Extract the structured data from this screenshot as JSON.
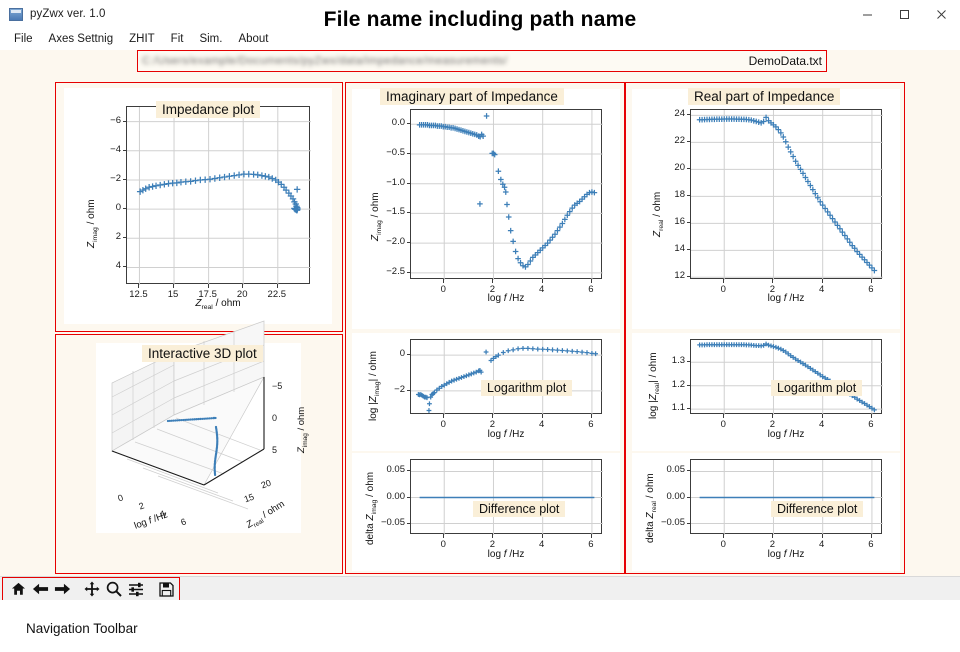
{
  "window": {
    "app_title": "pyZwx ver. 1.0",
    "app_icon": "app-icon",
    "minimize_label": "–",
    "maximize_label": "□",
    "close_label": "✕"
  },
  "menubar": {
    "items": [
      {
        "label": "File"
      },
      {
        "label": "Axes Settnig"
      },
      {
        "label": "ZHIT"
      },
      {
        "label": "Fit"
      },
      {
        "label": "Sim."
      },
      {
        "label": "About"
      }
    ]
  },
  "overlay": {
    "title": "File name including path name"
  },
  "pathfield": {
    "blurred_path": "C:/Users/example/Documents/pyZwx/data/impedance/measurements/",
    "filename": "DemoData.txt"
  },
  "panels": {
    "nyquist_label": "Impedance plot",
    "threed_label": "Interactive  3D plot",
    "imag_label": "Imaginary part of Impedance",
    "real_label": "Real part of Impedance",
    "log_imag_label": "Logarithm plot",
    "log_real_label": "Logarithm plot",
    "diff_imag_label": "Difference plot",
    "diff_real_label": "Difference plot"
  },
  "toolbar": {
    "caption": "Navigation Toolbar",
    "buttons": [
      {
        "name": "home-icon",
        "label": "Home"
      },
      {
        "name": "back-arrow-icon",
        "label": "Back"
      },
      {
        "name": "forward-arrow-icon",
        "label": "Forward"
      },
      {
        "name": "pan-move-icon",
        "label": "Pan"
      },
      {
        "name": "zoom-magnifier-icon",
        "label": "Zoom"
      },
      {
        "name": "configure-subplots-icon",
        "label": "Configure subplots"
      },
      {
        "name": "save-disk-icon",
        "label": "Save"
      }
    ]
  },
  "colors": {
    "accent_red": "#e60000",
    "marker_blue": "#3d7fb8",
    "background_cream": "#fdf8ef",
    "chip_cream": "#faefd8"
  },
  "chart_data": [
    {
      "id": "nyquist",
      "type": "scatter",
      "title": "Impedance plot",
      "xlabel": "Z_real / ohm",
      "ylabel": "Z_imag / ohm",
      "xlim": [
        11.6,
        24.9
      ],
      "ylim": [
        -7.0,
        5.2
      ],
      "y_inverted": true,
      "xticks": [
        12.5,
        15.0,
        17.5,
        20.0,
        22.5
      ],
      "yticks": [
        -6,
        -4,
        -2,
        0,
        2,
        4
      ],
      "grid": true,
      "marker": "plus",
      "x": [
        12.55,
        12.75,
        12.95,
        13.2,
        13.45,
        13.7,
        14.0,
        14.3,
        14.6,
        14.9,
        15.2,
        15.5,
        15.85,
        16.2,
        16.55,
        16.9,
        17.25,
        17.6,
        17.95,
        18.3,
        18.65,
        19.0,
        19.35,
        19.7,
        20.05,
        20.4,
        20.75,
        21.05,
        21.35,
        21.6,
        21.85,
        22.1,
        22.35,
        22.55,
        22.75,
        22.95,
        23.1,
        23.3,
        23.45,
        23.6,
        23.7,
        23.8,
        23.85,
        23.9,
        23.92,
        23.9,
        23.88,
        23.85,
        23.8,
        23.75,
        23.7,
        23.9
      ],
      "y": [
        -1.2,
        -1.3,
        -1.4,
        -1.5,
        -1.55,
        -1.6,
        -1.65,
        -1.7,
        -1.75,
        -1.78,
        -1.8,
        -1.85,
        -1.88,
        -1.9,
        -1.95,
        -2.0,
        -2.02,
        -2.05,
        -2.1,
        -2.15,
        -2.2,
        -2.25,
        -2.3,
        -2.35,
        -2.4,
        -2.4,
        -2.38,
        -2.35,
        -2.3,
        -2.25,
        -2.2,
        -2.1,
        -2.0,
        -1.85,
        -1.7,
        -1.5,
        -1.3,
        -1.1,
        -0.9,
        -0.7,
        -0.5,
        -0.35,
        -0.2,
        -0.1,
        -0.02,
        0.05,
        0.08,
        0.05,
        0.02,
        0.0,
        -0.05,
        -1.35
      ]
    },
    {
      "id": "imaginary",
      "type": "scatter",
      "title": "Imaginary part of Impedance",
      "xlabel": "log f /Hz",
      "ylabel": "Z_imag / ohm",
      "xlim": [
        -1.35,
        6.45
      ],
      "ylim": [
        -2.62,
        0.24
      ],
      "xticks": [
        0,
        2,
        4,
        6
      ],
      "yticks": [
        0.0,
        -0.5,
        -1.0,
        -1.5,
        -2.0,
        -2.5
      ],
      "grid": true,
      "marker": "plus",
      "x": [
        -1.0,
        -0.92,
        -0.84,
        -0.76,
        -0.68,
        -0.6,
        -0.52,
        -0.44,
        -0.36,
        -0.28,
        -0.2,
        -0.12,
        -0.04,
        0.04,
        0.12,
        0.2,
        0.28,
        0.36,
        0.44,
        0.52,
        0.6,
        0.68,
        0.76,
        0.84,
        0.92,
        1.0,
        1.08,
        1.16,
        1.24,
        1.32,
        1.4,
        1.46,
        1.52,
        1.58,
        1.45,
        1.95,
        2.0,
        2.05,
        1.72,
        2.2,
        2.3,
        2.38,
        2.45,
        2.5,
        2.55,
        2.62,
        2.7,
        2.8,
        2.9,
        3.0,
        3.1,
        3.2,
        3.3,
        3.4,
        3.5,
        3.6,
        3.7,
        3.8,
        3.9,
        4.0,
        4.1,
        4.2,
        4.3,
        4.4,
        4.5,
        4.6,
        4.7,
        4.8,
        4.9,
        5.0,
        5.1,
        5.2,
        5.3,
        5.4,
        5.5,
        5.6,
        5.7,
        5.8,
        5.9,
        6.0,
        6.1
      ],
      "y": [
        -0.01,
        -0.01,
        -0.01,
        -0.01,
        -0.01,
        -0.02,
        -0.02,
        -0.02,
        -0.02,
        -0.03,
        -0.03,
        -0.03,
        -0.04,
        -0.04,
        -0.05,
        -0.05,
        -0.06,
        -0.06,
        -0.07,
        -0.08,
        -0.09,
        -0.1,
        -0.11,
        -0.12,
        -0.13,
        -0.14,
        -0.15,
        -0.16,
        -0.17,
        -0.18,
        -0.2,
        -0.21,
        -0.17,
        -0.2,
        -1.34,
        -0.49,
        -0.49,
        -0.51,
        0.14,
        -0.79,
        -0.93,
        -1.01,
        -1.06,
        -1.14,
        -1.35,
        -1.56,
        -1.79,
        -1.97,
        -2.14,
        -2.26,
        -2.33,
        -2.38,
        -2.4,
        -2.36,
        -2.3,
        -2.24,
        -2.2,
        -2.16,
        -2.12,
        -2.08,
        -2.04,
        -2.0,
        -1.95,
        -1.9,
        -1.85,
        -1.79,
        -1.73,
        -1.67,
        -1.6,
        -1.53,
        -1.47,
        -1.41,
        -1.36,
        -1.33,
        -1.3,
        -1.26,
        -1.22,
        -1.18,
        -1.15,
        -1.14,
        -1.15
      ]
    },
    {
      "id": "real",
      "type": "scatter",
      "title": "Real part of Impedance",
      "xlabel": "log f /Hz",
      "ylabel": "Z_real / ohm",
      "xlim": [
        -1.35,
        6.45
      ],
      "ylim": [
        11.8,
        24.4
      ],
      "xticks": [
        0,
        2,
        4,
        6
      ],
      "yticks": [
        12,
        14,
        16,
        18,
        20,
        22,
        24
      ],
      "grid": true,
      "marker": "plus",
      "x": [
        -1.0,
        -0.9,
        -0.8,
        -0.7,
        -0.6,
        -0.5,
        -0.4,
        -0.3,
        -0.2,
        -0.1,
        0.0,
        0.1,
        0.2,
        0.3,
        0.4,
        0.5,
        0.6,
        0.7,
        0.8,
        0.9,
        1.0,
        1.1,
        1.2,
        1.3,
        1.4,
        1.5,
        1.6,
        1.7,
        1.8,
        1.9,
        2.0,
        2.1,
        2.2,
        2.3,
        2.4,
        2.5,
        2.6,
        2.7,
        2.8,
        2.9,
        3.0,
        3.1,
        3.2,
        3.3,
        3.4,
        3.5,
        3.6,
        3.7,
        3.8,
        3.9,
        4.0,
        4.1,
        4.2,
        4.3,
        4.4,
        4.5,
        4.6,
        4.7,
        4.8,
        4.9,
        5.0,
        5.1,
        5.2,
        5.3,
        5.4,
        5.5,
        5.6,
        5.7,
        5.8,
        5.9,
        6.0,
        6.1
      ],
      "y": [
        23.68,
        23.68,
        23.69,
        23.7,
        23.7,
        23.71,
        23.71,
        23.72,
        23.72,
        23.72,
        23.73,
        23.73,
        23.73,
        23.73,
        23.73,
        23.72,
        23.72,
        23.71,
        23.71,
        23.7,
        23.68,
        23.65,
        23.6,
        23.55,
        23.5,
        23.45,
        23.55,
        23.85,
        23.6,
        23.45,
        23.3,
        23.15,
        22.95,
        22.7,
        22.4,
        22.05,
        21.65,
        21.3,
        20.95,
        20.6,
        20.3,
        20.0,
        19.7,
        19.4,
        19.1,
        18.8,
        18.5,
        18.2,
        17.9,
        17.6,
        17.35,
        17.1,
        16.85,
        16.6,
        16.35,
        16.1,
        15.85,
        15.6,
        15.35,
        15.1,
        14.85,
        14.6,
        14.35,
        14.15,
        13.9,
        13.7,
        13.5,
        13.3,
        13.1,
        12.9,
        12.7,
        12.5
      ]
    },
    {
      "id": "log-imag",
      "type": "scatter",
      "title": "Logarithm plot",
      "xlabel": "log f /Hz",
      "ylabel": "log |Z_imag| / ohm",
      "xlim": [
        -1.35,
        6.45
      ],
      "ylim": [
        -3.35,
        0.85
      ],
      "xticks": [
        0,
        2,
        4,
        6
      ],
      "yticks": [
        0,
        -2
      ],
      "grid": true,
      "marker": "plus",
      "x": [
        -1.05,
        -1.0,
        -0.95,
        -0.9,
        -0.85,
        -0.8,
        -0.75,
        -0.7,
        -0.62,
        -0.6,
        -0.55,
        -0.5,
        -0.45,
        -0.4,
        -0.3,
        -0.2,
        -0.1,
        0.0,
        0.1,
        0.2,
        0.3,
        0.4,
        0.5,
        0.6,
        0.7,
        0.8,
        0.9,
        1.0,
        1.1,
        1.2,
        1.3,
        1.4,
        1.45,
        1.5,
        1.7,
        1.9,
        2.0,
        2.1,
        2.2,
        2.4,
        2.6,
        2.8,
        3.0,
        3.2,
        3.4,
        3.6,
        3.8,
        4.0,
        4.2,
        4.4,
        4.6,
        4.8,
        5.0,
        5.2,
        5.4,
        5.6,
        5.8,
        6.0,
        6.15
      ],
      "y": [
        -2.2,
        -2.22,
        -2.2,
        -2.25,
        -2.3,
        -2.35,
        -2.35,
        -2.38,
        -3.1,
        -2.72,
        -2.35,
        -2.2,
        -2.15,
        -2.1,
        -1.95,
        -1.85,
        -1.75,
        -1.68,
        -1.6,
        -1.52,
        -1.45,
        -1.4,
        -1.35,
        -1.3,
        -1.25,
        -1.2,
        -1.15,
        -1.1,
        -1.05,
        -1.0,
        -0.95,
        -0.88,
        -0.85,
        -0.95,
        0.18,
        -0.3,
        -0.18,
        -0.08,
        0.0,
        0.15,
        0.25,
        0.3,
        0.36,
        0.38,
        0.38,
        0.36,
        0.34,
        0.33,
        0.32,
        0.3,
        0.28,
        0.26,
        0.24,
        0.22,
        0.2,
        0.17,
        0.14,
        0.1,
        0.08
      ]
    },
    {
      "id": "log-real",
      "type": "scatter",
      "title": "Logarithm plot",
      "xlabel": "log f /Hz",
      "ylabel": "log |Z_real| / ohm",
      "xlim": [
        -1.35,
        6.45
      ],
      "ylim": [
        1.075,
        1.395
      ],
      "xticks": [
        0,
        2,
        4,
        6
      ],
      "yticks": [
        1.1,
        1.2,
        1.3
      ],
      "grid": true,
      "marker": "plus",
      "x": [
        -1.0,
        -0.9,
        -0.8,
        -0.7,
        -0.6,
        -0.5,
        -0.4,
        -0.3,
        -0.2,
        -0.1,
        0.0,
        0.1,
        0.2,
        0.3,
        0.4,
        0.5,
        0.6,
        0.7,
        0.8,
        0.9,
        1.0,
        1.1,
        1.2,
        1.3,
        1.4,
        1.5,
        1.6,
        1.7,
        1.8,
        1.9,
        2.0,
        2.1,
        2.2,
        2.3,
        2.4,
        2.5,
        2.6,
        2.7,
        2.8,
        2.9,
        3.0,
        3.1,
        3.2,
        3.3,
        3.4,
        3.5,
        3.6,
        3.7,
        3.8,
        3.9,
        4.0,
        4.1,
        4.2,
        4.3,
        4.4,
        4.5,
        4.6,
        4.7,
        4.8,
        4.9,
        5.0,
        5.1,
        5.2,
        5.3,
        5.4,
        5.5,
        5.6,
        5.7,
        5.8,
        5.9,
        6.0,
        6.1
      ],
      "y": [
        1.374,
        1.374,
        1.374,
        1.375,
        1.375,
        1.375,
        1.375,
        1.375,
        1.375,
        1.375,
        1.375,
        1.375,
        1.375,
        1.375,
        1.375,
        1.375,
        1.375,
        1.375,
        1.375,
        1.374,
        1.374,
        1.373,
        1.372,
        1.371,
        1.371,
        1.37,
        1.372,
        1.378,
        1.373,
        1.37,
        1.367,
        1.364,
        1.36,
        1.356,
        1.35,
        1.344,
        1.336,
        1.328,
        1.321,
        1.314,
        1.307,
        1.301,
        1.294,
        1.288,
        1.281,
        1.274,
        1.267,
        1.26,
        1.253,
        1.246,
        1.239,
        1.233,
        1.227,
        1.22,
        1.213,
        1.207,
        1.2,
        1.193,
        1.186,
        1.179,
        1.172,
        1.164,
        1.157,
        1.151,
        1.143,
        1.137,
        1.13,
        1.124,
        1.117,
        1.111,
        1.104,
        1.097
      ]
    },
    {
      "id": "diff-imag",
      "type": "line",
      "title": "Difference plot",
      "xlabel": "log f /Hz",
      "ylabel": "delta Z_imag / ohm",
      "xlim": [
        -1.35,
        6.45
      ],
      "ylim": [
        -0.072,
        0.072
      ],
      "xticks": [
        0,
        2,
        4,
        6
      ],
      "yticks": [
        0.05,
        0.0,
        -0.05
      ],
      "grid": true,
      "x": [
        -1.0,
        6.1
      ],
      "y": [
        0.0,
        0.0
      ]
    },
    {
      "id": "diff-real",
      "type": "line",
      "title": "Difference plot",
      "xlabel": "log f /Hz",
      "ylabel": "delta Z_real / ohm",
      "xlim": [
        -1.35,
        6.45
      ],
      "ylim": [
        -0.072,
        0.072
      ],
      "xticks": [
        0,
        2,
        4,
        6
      ],
      "yticks": [
        0.05,
        0.0,
        -0.05
      ],
      "grid": true,
      "x": [
        -1.0,
        6.1
      ],
      "y": [
        0.0,
        0.0
      ]
    },
    {
      "id": "threed",
      "type": "scatter3d",
      "title": "Interactive  3D plot",
      "xlabel": "log f /Hz",
      "ylabel": "Z_real / ohm",
      "zlabel": "Z_imag / ohm",
      "xticks": [
        0,
        2,
        4,
        6
      ],
      "yticks": [
        15,
        20
      ],
      "zticks": [
        -5,
        0,
        5
      ],
      "grid": true
    }
  ]
}
